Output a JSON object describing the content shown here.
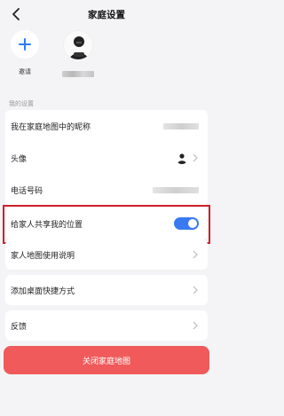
{
  "header": {
    "title": "家庭设置"
  },
  "members": {
    "invite_label": "邀请"
  },
  "settings": {
    "section_title": "我的设置",
    "nickname_label": "我在家庭地图中的昵称",
    "avatar_label": "头像",
    "phone_label": "电话号码"
  },
  "share_location": {
    "label": "给家人共享我的位置",
    "enabled": true
  },
  "help": {
    "label": "家人地图使用说明"
  },
  "shortcut": {
    "label": "添加桌面快捷方式"
  },
  "feedback": {
    "label": "反馈"
  },
  "footer": {
    "close_button_label": "关闭家庭地图"
  },
  "colors": {
    "accent": "#3a7af0",
    "danger_button": "#f05a5a",
    "highlight_border": "#d0202a"
  }
}
